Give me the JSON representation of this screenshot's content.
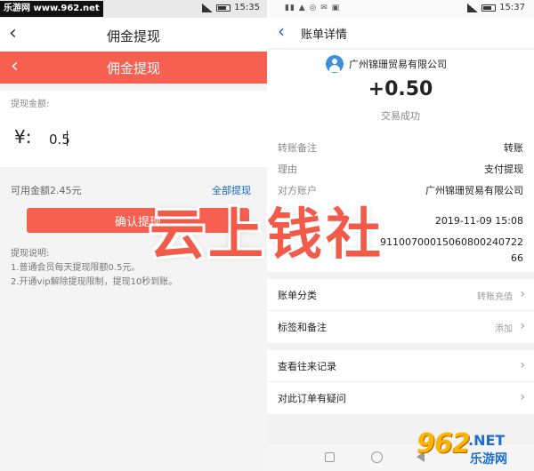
{
  "left": {
    "status_bar": {
      "watermark": "乐游网 www.962.net",
      "time": "15:35"
    },
    "header": {
      "title": "佣金提现"
    },
    "red_header": {
      "title": "佣金提现"
    },
    "amount": {
      "label": "提现金额:",
      "symbol": "¥:",
      "value": "0.5"
    },
    "balance": {
      "available": "可用金额2.45元",
      "withdraw_all": "全部提现"
    },
    "confirm_label": "确认提现",
    "notes": {
      "title": "提现说明:",
      "lines": [
        "1.普通会员每天提现限额0.5元。",
        "2.开通vip解除提现限制，提现10秒到账。"
      ]
    }
  },
  "right": {
    "status_bar": {
      "time": "15:37"
    },
    "header": {
      "title": "账单详情"
    },
    "merchant": "广州锦珊贸易有限公司",
    "amount": "+0.50",
    "trade_status": "交易成功",
    "details": [
      {
        "label": "转账备注",
        "value": "转账"
      },
      {
        "label": "理由",
        "value": "支付提现"
      },
      {
        "label": "对方账户",
        "value": "广州锦珊贸易有限公司"
      },
      {
        "label": "",
        "value": "2019-11-09 15:08"
      },
      {
        "label": "",
        "value": "91100700015060800240722"
      },
      {
        "label": "",
        "value": "66"
      }
    ],
    "menu_group_1": [
      {
        "label": "账单分类",
        "value": "转账充值"
      },
      {
        "label": "标签和备注",
        "value": "添加"
      }
    ],
    "menu_group_2": [
      {
        "label": "查看往来记录",
        "value": ""
      },
      {
        "label": "对此订单有疑问",
        "value": ""
      }
    ]
  },
  "overlay_text": "云上钱社",
  "watermark_logo": {
    "number": "962",
    "net": ".NET",
    "cn": "乐游网"
  },
  "colors": {
    "accent_red": "#f76050",
    "link_blue": "#1565c0",
    "overlay_red": "#f25b4a"
  }
}
